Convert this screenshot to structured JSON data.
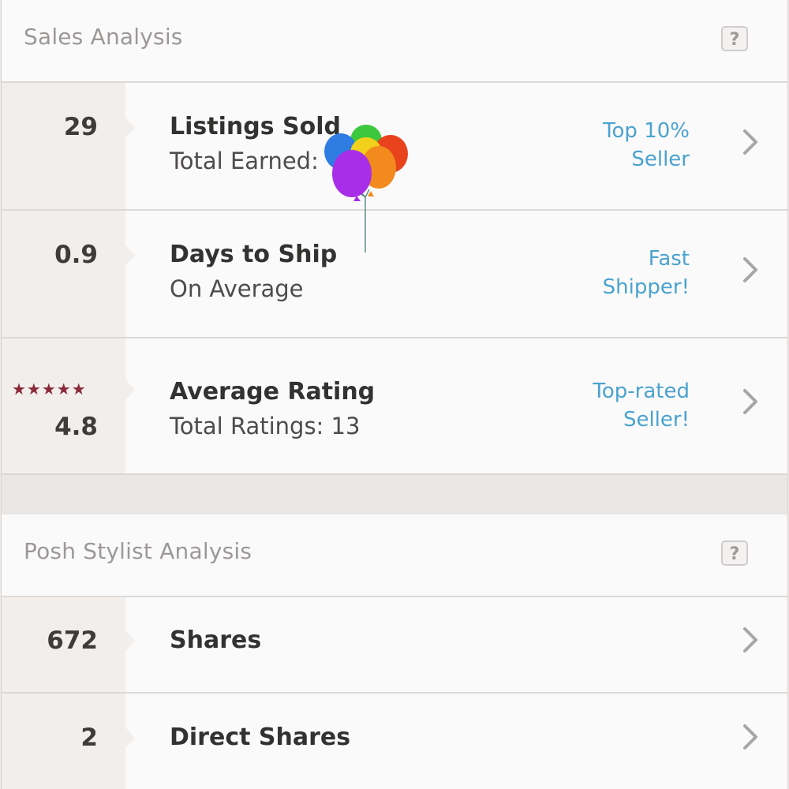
{
  "sales_analysis": {
    "title": "Sales Analysis",
    "help": "?",
    "rows": [
      {
        "stat": "29",
        "label": "Listings Sold",
        "sublabel": "Total Earned:",
        "badge": [
          "Top 10%",
          "Seller"
        ]
      },
      {
        "stat": "0.9",
        "label": "Days to Ship",
        "sublabel": "On Average",
        "badge": [
          "Fast",
          "Shipper!"
        ]
      },
      {
        "stars": "★★★★★",
        "rating": 4.8,
        "stat": "4.8",
        "label": "Average Rating",
        "sublabel": "Total Ratings: 13",
        "badge": [
          "Top-rated",
          "Seller!"
        ]
      }
    ]
  },
  "posh_stylist_analysis": {
    "title": "Posh Stylist Analysis",
    "help": "?",
    "rows": [
      {
        "stat": "672",
        "label": "Shares"
      },
      {
        "stat": "2",
        "label": "Direct Shares"
      }
    ]
  },
  "icons": {
    "chevron": "chevron-right-icon",
    "help": "help-icon",
    "celebration": "balloons-icon"
  },
  "colors": {
    "accent": "#4aa3cf",
    "stars": "#8b2a39",
    "stat_column": "#f1eeeb"
  }
}
